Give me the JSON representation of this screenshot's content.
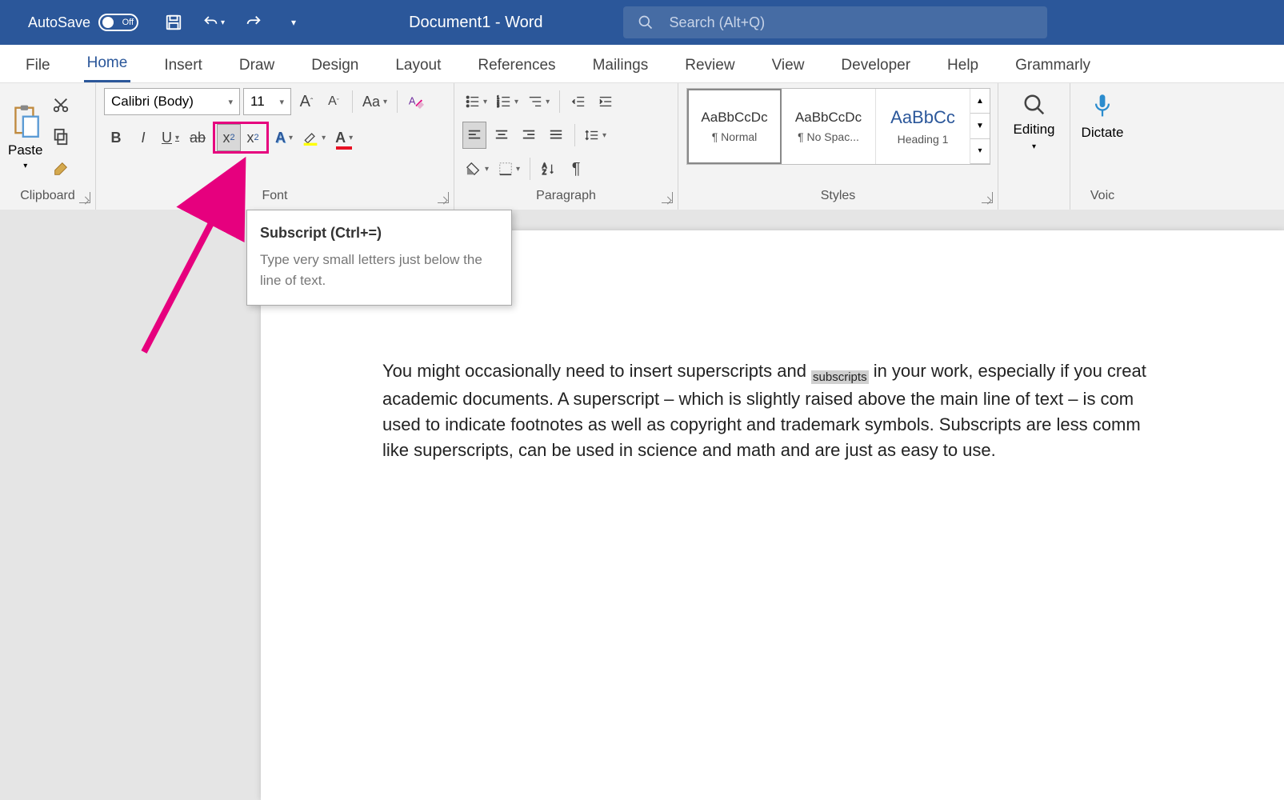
{
  "titlebar": {
    "autosave_label": "AutoSave",
    "autosave_state": "Off",
    "doc_title": "Document1  -  Word",
    "search_placeholder": "Search (Alt+Q)"
  },
  "tabs": [
    "File",
    "Home",
    "Insert",
    "Draw",
    "Design",
    "Layout",
    "References",
    "Mailings",
    "Review",
    "View",
    "Developer",
    "Help",
    "Grammarly"
  ],
  "active_tab": "Home",
  "clipboard": {
    "paste": "Paste",
    "label": "Clipboard"
  },
  "font": {
    "name": "Calibri (Body)",
    "size": "11",
    "label": "Font",
    "grow": "A",
    "shrink": "A",
    "case": "Aa",
    "bold": "B",
    "italic": "I",
    "underline": "U",
    "strike": "ab",
    "subscript": "x",
    "subscript_sub": "2",
    "superscript": "x",
    "superscript_sup": "2",
    "text_effects": "A",
    "font_color": "A"
  },
  "paragraph": {
    "label": "Paragraph"
  },
  "styles": {
    "label": "Styles",
    "preview": "AaBbCcDc",
    "heading_preview": "AaBbCc",
    "items": [
      {
        "name": "¶ Normal"
      },
      {
        "name": "¶ No Spac..."
      },
      {
        "name": "Heading 1"
      }
    ]
  },
  "editing": {
    "label": "Editing"
  },
  "dictate": {
    "label": "Dictate"
  },
  "voice": {
    "label": "Voic"
  },
  "tooltip": {
    "title": "Subscript (Ctrl+=)",
    "body": "Type very small letters just below the line of text."
  },
  "document": {
    "line1_a": "You might occasionally need to insert superscripts and ",
    "line1_sub": "subscripts",
    "line1_b": " in your work, especially if you creat",
    "line2": "academic documents. A superscript – which is slightly raised above the main line of text – is com",
    "line3": "used to indicate footnotes as well as copyright and trademark symbols. Subscripts are less comm",
    "line4": "like superscripts, can be used in science and math and are just as easy to use."
  }
}
